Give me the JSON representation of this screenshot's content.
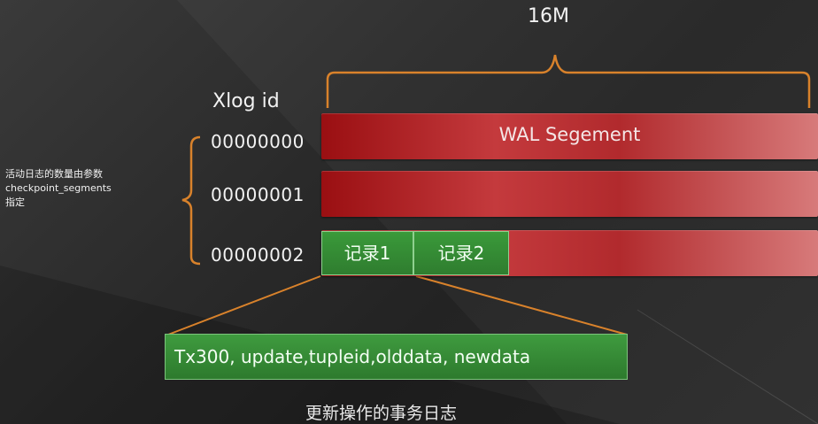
{
  "size_label": "16M",
  "column_header": "Xlog id",
  "xlog_ids": [
    "00000000",
    "00000001",
    "00000002"
  ],
  "note": {
    "line1": "活动日志的数量由参数",
    "line2": "checkpoint_segments",
    "line3": "指定"
  },
  "segment_label": "WAL Segement",
  "records": [
    "记录1",
    "记录2"
  ],
  "tx_detail": "Tx300, update,tupleid,olddata, newdata",
  "caption": "更新操作的事务日志",
  "colors": {
    "segment_red": "#b12a2d",
    "record_green": "#2f7d2f",
    "brace_orange": "#d9822b"
  }
}
